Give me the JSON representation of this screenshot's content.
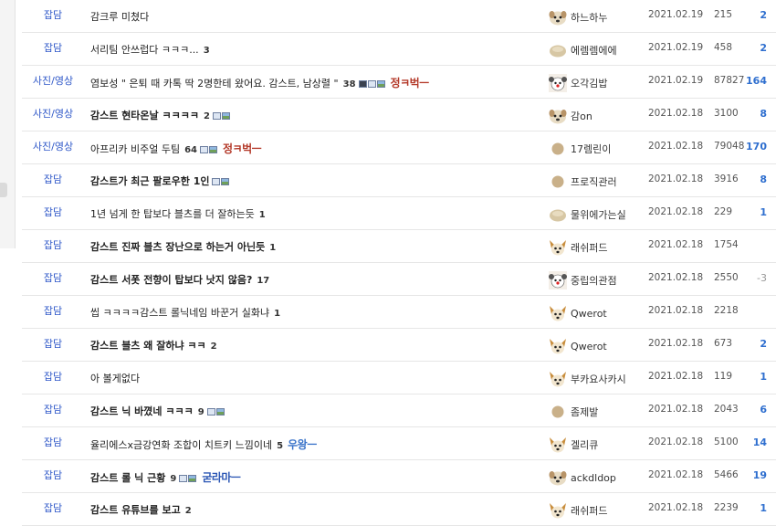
{
  "colors": {
    "category": "#2f58c8",
    "rec_positive": "#2f6fcf",
    "rec_negative": "#999999",
    "sig_red": "#b43a2a",
    "sig_blue": "#3a73c9",
    "sig_blue_dark": "#2d58b5"
  },
  "posts": [
    {
      "category": "잡담",
      "title": "감크루 미쳤다",
      "bold": false,
      "comments": "",
      "media": [],
      "sig": null,
      "author": "하느하누",
      "avatar": "dog-avatar",
      "date": "2021.02.19",
      "views": "215",
      "recs": "2"
    },
    {
      "category": "잡담",
      "title": "서리팀 안쓰럽다 ㅋㅋㅋ...",
      "bold": false,
      "comments": "3",
      "media": [],
      "sig": null,
      "author": "에렘렘에에",
      "avatar": "blob-avatar",
      "date": "2021.02.19",
      "views": "458",
      "recs": "2"
    },
    {
      "category": "사진/영상",
      "title": "염보성 \" 은퇴 때 카톡 딱 2명한테 왔어요. 감스트, 남상렬 \"",
      "bold": false,
      "comments": "38",
      "media": [
        "vid",
        "doc",
        "pic"
      ],
      "sig": {
        "text": "정ㅋ벅ㅡ",
        "color": "sig_red"
      },
      "author": "오각김밥",
      "avatar": "clown-avatar",
      "date": "2021.02.19",
      "views": "87827",
      "recs": "164"
    },
    {
      "category": "사진/영상",
      "title": "감스트 현타온날 ㅋㅋㅋㅋ",
      "bold": true,
      "comments": "2",
      "media": [
        "doc",
        "pic"
      ],
      "sig": null,
      "author": "감on",
      "avatar": "dog-avatar",
      "date": "2021.02.18",
      "views": "3100",
      "recs": "8"
    },
    {
      "category": "사진/영상",
      "title": "아프리카 비주얼 두팀",
      "bold": false,
      "comments": "64",
      "media": [
        "doc",
        "pic"
      ],
      "sig": {
        "text": "정ㅋ벅ㅡ",
        "color": "sig_red"
      },
      "author": "17렘린이",
      "avatar": "dot-avatar",
      "date": "2021.02.18",
      "views": "79048",
      "recs": "170"
    },
    {
      "category": "잡담",
      "title": "감스트가 최근 팔로우한 1인",
      "bold": true,
      "comments": "",
      "media": [
        "doc",
        "pic"
      ],
      "sig": null,
      "author": "프로직관러",
      "avatar": "dot-avatar",
      "date": "2021.02.18",
      "views": "3916",
      "recs": "8"
    },
    {
      "category": "잡담",
      "title": "1년 넘게 한 탑보다 블츠를 더 잘하는듯",
      "bold": false,
      "comments": "1",
      "media": [],
      "sig": null,
      "author": "물위에가는실",
      "avatar": "blob-avatar",
      "date": "2021.02.18",
      "views": "229",
      "recs": "1"
    },
    {
      "category": "잡담",
      "title": "감스트 진짜 블츠 장난으로 하는거 아닌듯",
      "bold": true,
      "comments": "1",
      "media": [],
      "sig": null,
      "author": "래쉬퍼드",
      "avatar": "fox-avatar",
      "date": "2021.02.18",
      "views": "1754",
      "recs": ""
    },
    {
      "category": "잡담",
      "title": "감스트 서폿 전향이 탑보다 낫지 않음?",
      "bold": true,
      "comments": "17",
      "media": [],
      "sig": null,
      "author": "중립의관점",
      "avatar": "clown-avatar",
      "date": "2021.02.18",
      "views": "2550",
      "recs": "-3"
    },
    {
      "category": "잡담",
      "title": "씹 ㅋㅋㅋㅋ감스트 롤닉네임 바꾼거 실화냐",
      "bold": false,
      "comments": "1",
      "media": [],
      "sig": null,
      "author": "Qwerot",
      "avatar": "fox-avatar",
      "date": "2021.02.18",
      "views": "2218",
      "recs": ""
    },
    {
      "category": "잡담",
      "title": "감스트 블츠 왜 잘하냐 ㅋㅋ",
      "bold": true,
      "comments": "2",
      "media": [],
      "sig": null,
      "author": "Qwerot",
      "avatar": "fox-avatar",
      "date": "2021.02.18",
      "views": "673",
      "recs": "2"
    },
    {
      "category": "잡담",
      "title": "아 볼게없다",
      "bold": false,
      "comments": "",
      "media": [],
      "sig": null,
      "author": "부카요사카시",
      "avatar": "fox-avatar",
      "date": "2021.02.18",
      "views": "119",
      "recs": "1"
    },
    {
      "category": "잡담",
      "title": "감스트 닉 바꼈네 ㅋㅋㅋ",
      "bold": true,
      "comments": "9",
      "media": [
        "doc",
        "pic"
      ],
      "sig": null,
      "author": "좀제발",
      "avatar": "dot-avatar",
      "date": "2021.02.18",
      "views": "2043",
      "recs": "6"
    },
    {
      "category": "잡담",
      "title": "율리에스x금강연화 조합이 치트키 느낌이네",
      "bold": false,
      "comments": "5",
      "media": [],
      "sig": {
        "text": "우왕ㅡ",
        "color": "sig_blue"
      },
      "author": "겔리큐",
      "avatar": "fox-avatar",
      "date": "2021.02.18",
      "views": "5100",
      "recs": "14"
    },
    {
      "category": "잡담",
      "title": "감스트 롤 닉 근황",
      "bold": true,
      "comments": "9",
      "media": [
        "doc",
        "pic"
      ],
      "sig": {
        "text": "굳라마ㅡ",
        "color": "sig_blue_dark"
      },
      "author": "ackdldop",
      "avatar": "dog-avatar",
      "date": "2021.02.18",
      "views": "5466",
      "recs": "19"
    },
    {
      "category": "잡담",
      "title": "감스트 유튜브를 보고",
      "bold": true,
      "comments": "2",
      "media": [],
      "sig": null,
      "author": "래쉬퍼드",
      "avatar": "fox-avatar",
      "date": "2021.02.18",
      "views": "2239",
      "recs": "1"
    }
  ]
}
